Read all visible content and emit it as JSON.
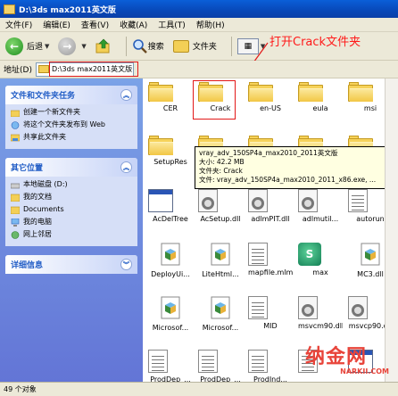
{
  "window": {
    "title": "D:\\3ds max2011英文版"
  },
  "menu": [
    "文件(F)",
    "编辑(E)",
    "查看(V)",
    "收藏(A)",
    "工具(T)",
    "帮助(H)"
  ],
  "toolbar": {
    "back_label": "后退",
    "search_label": "搜索",
    "folders_label": "文件夹"
  },
  "address": {
    "label": "地址(D)",
    "path": "D:\\3ds max2011英文版"
  },
  "annotation": {
    "text": "打开Crack文件夹",
    "color": "#ff1a1a"
  },
  "sidebar": {
    "tasks_title": "文件和文件夹任务",
    "tasks": [
      "创建一个新文件夹",
      "将这个文件夹发布到 Web",
      "共享此文件夹"
    ],
    "places_title": "其它位置",
    "places": [
      "本地磁盘 (D:)",
      "我的文档",
      "Documents",
      "我的电脑",
      "网上邻居"
    ],
    "details_title": "详细信息"
  },
  "files": [
    {
      "name": "CER",
      "type": "folder"
    },
    {
      "name": "Crack",
      "type": "folder"
    },
    {
      "name": "en-US",
      "type": "folder"
    },
    {
      "name": "eula",
      "type": "folder"
    },
    {
      "name": "msi",
      "type": "folder"
    },
    {
      "name": "SetupRes",
      "type": "folder"
    },
    {
      "name": "",
      "type": "folder"
    },
    {
      "name": "",
      "type": "folder"
    },
    {
      "name": "",
      "type": "folder"
    },
    {
      "name": "",
      "type": "folder"
    },
    {
      "name": "AcDelTree",
      "type": "exe"
    },
    {
      "name": "AcSetup.dll",
      "type": "dll"
    },
    {
      "name": "adlmPIT.dll",
      "type": "dll"
    },
    {
      "name": "adlmutil...",
      "type": "dll"
    },
    {
      "name": "autorun",
      "type": "doc"
    },
    {
      "name": "DeployUi...",
      "type": "cube"
    },
    {
      "name": "LiteHtml...",
      "type": "cube"
    },
    {
      "name": "mapfile.mlm",
      "type": "doc"
    },
    {
      "name": "max",
      "type": "max"
    },
    {
      "name": "MC3.dll",
      "type": "cube"
    },
    {
      "name": "Microsof...",
      "type": "cube"
    },
    {
      "name": "Microsof...",
      "type": "cube"
    },
    {
      "name": "MID",
      "type": "doc"
    },
    {
      "name": "msvcm90.dll",
      "type": "dll"
    },
    {
      "name": "msvcp90.dll",
      "type": "dll"
    },
    {
      "name": "ProdDep_...",
      "type": "doc"
    },
    {
      "name": "ProdDep_...",
      "type": "doc"
    },
    {
      "name": "ProdInd...",
      "type": "doc"
    },
    {
      "name": "",
      "type": "doc"
    },
    {
      "name": "",
      "type": "exe"
    }
  ],
  "tooltip": {
    "line1": "vray_adv_150SP4a_max2010_2011英文版",
    "line2": "大小: 42.2 MB",
    "line3": "文件夹: Crack",
    "line4": "文件: vray_adv_150SP4a_max2010_2011_x86.exe, ..."
  },
  "status": {
    "text": "49 个对象"
  },
  "watermark": {
    "cn": "纳金网",
    "en": "NARKII.COM"
  }
}
